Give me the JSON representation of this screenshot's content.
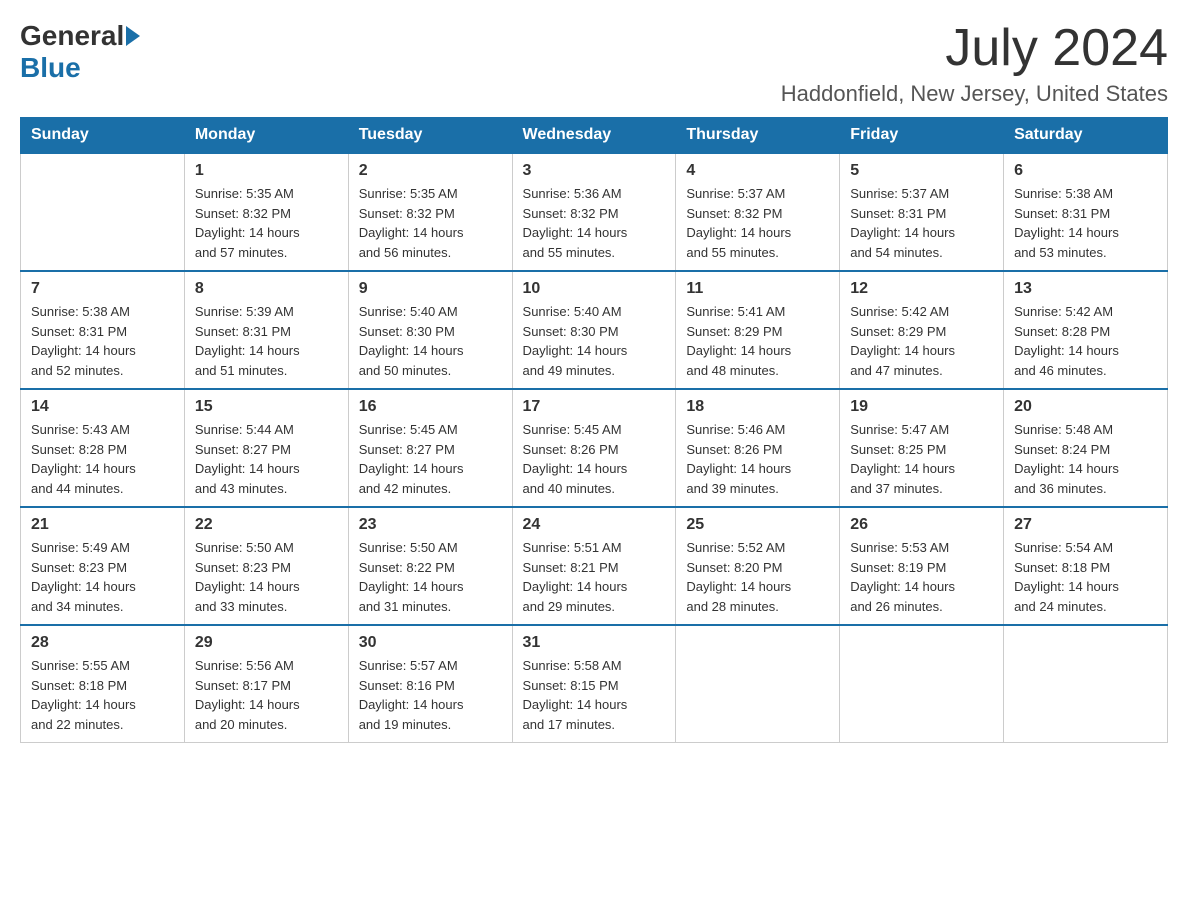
{
  "logo": {
    "general": "General",
    "blue": "Blue"
  },
  "title": {
    "month_year": "July 2024",
    "location": "Haddonfield, New Jersey, United States"
  },
  "days_of_week": [
    "Sunday",
    "Monday",
    "Tuesday",
    "Wednesday",
    "Thursday",
    "Friday",
    "Saturday"
  ],
  "weeks": [
    [
      {
        "day": "",
        "info": ""
      },
      {
        "day": "1",
        "info": "Sunrise: 5:35 AM\nSunset: 8:32 PM\nDaylight: 14 hours\nand 57 minutes."
      },
      {
        "day": "2",
        "info": "Sunrise: 5:35 AM\nSunset: 8:32 PM\nDaylight: 14 hours\nand 56 minutes."
      },
      {
        "day": "3",
        "info": "Sunrise: 5:36 AM\nSunset: 8:32 PM\nDaylight: 14 hours\nand 55 minutes."
      },
      {
        "day": "4",
        "info": "Sunrise: 5:37 AM\nSunset: 8:32 PM\nDaylight: 14 hours\nand 55 minutes."
      },
      {
        "day": "5",
        "info": "Sunrise: 5:37 AM\nSunset: 8:31 PM\nDaylight: 14 hours\nand 54 minutes."
      },
      {
        "day": "6",
        "info": "Sunrise: 5:38 AM\nSunset: 8:31 PM\nDaylight: 14 hours\nand 53 minutes."
      }
    ],
    [
      {
        "day": "7",
        "info": "Sunrise: 5:38 AM\nSunset: 8:31 PM\nDaylight: 14 hours\nand 52 minutes."
      },
      {
        "day": "8",
        "info": "Sunrise: 5:39 AM\nSunset: 8:31 PM\nDaylight: 14 hours\nand 51 minutes."
      },
      {
        "day": "9",
        "info": "Sunrise: 5:40 AM\nSunset: 8:30 PM\nDaylight: 14 hours\nand 50 minutes."
      },
      {
        "day": "10",
        "info": "Sunrise: 5:40 AM\nSunset: 8:30 PM\nDaylight: 14 hours\nand 49 minutes."
      },
      {
        "day": "11",
        "info": "Sunrise: 5:41 AM\nSunset: 8:29 PM\nDaylight: 14 hours\nand 48 minutes."
      },
      {
        "day": "12",
        "info": "Sunrise: 5:42 AM\nSunset: 8:29 PM\nDaylight: 14 hours\nand 47 minutes."
      },
      {
        "day": "13",
        "info": "Sunrise: 5:42 AM\nSunset: 8:28 PM\nDaylight: 14 hours\nand 46 minutes."
      }
    ],
    [
      {
        "day": "14",
        "info": "Sunrise: 5:43 AM\nSunset: 8:28 PM\nDaylight: 14 hours\nand 44 minutes."
      },
      {
        "day": "15",
        "info": "Sunrise: 5:44 AM\nSunset: 8:27 PM\nDaylight: 14 hours\nand 43 minutes."
      },
      {
        "day": "16",
        "info": "Sunrise: 5:45 AM\nSunset: 8:27 PM\nDaylight: 14 hours\nand 42 minutes."
      },
      {
        "day": "17",
        "info": "Sunrise: 5:45 AM\nSunset: 8:26 PM\nDaylight: 14 hours\nand 40 minutes."
      },
      {
        "day": "18",
        "info": "Sunrise: 5:46 AM\nSunset: 8:26 PM\nDaylight: 14 hours\nand 39 minutes."
      },
      {
        "day": "19",
        "info": "Sunrise: 5:47 AM\nSunset: 8:25 PM\nDaylight: 14 hours\nand 37 minutes."
      },
      {
        "day": "20",
        "info": "Sunrise: 5:48 AM\nSunset: 8:24 PM\nDaylight: 14 hours\nand 36 minutes."
      }
    ],
    [
      {
        "day": "21",
        "info": "Sunrise: 5:49 AM\nSunset: 8:23 PM\nDaylight: 14 hours\nand 34 minutes."
      },
      {
        "day": "22",
        "info": "Sunrise: 5:50 AM\nSunset: 8:23 PM\nDaylight: 14 hours\nand 33 minutes."
      },
      {
        "day": "23",
        "info": "Sunrise: 5:50 AM\nSunset: 8:22 PM\nDaylight: 14 hours\nand 31 minutes."
      },
      {
        "day": "24",
        "info": "Sunrise: 5:51 AM\nSunset: 8:21 PM\nDaylight: 14 hours\nand 29 minutes."
      },
      {
        "day": "25",
        "info": "Sunrise: 5:52 AM\nSunset: 8:20 PM\nDaylight: 14 hours\nand 28 minutes."
      },
      {
        "day": "26",
        "info": "Sunrise: 5:53 AM\nSunset: 8:19 PM\nDaylight: 14 hours\nand 26 minutes."
      },
      {
        "day": "27",
        "info": "Sunrise: 5:54 AM\nSunset: 8:18 PM\nDaylight: 14 hours\nand 24 minutes."
      }
    ],
    [
      {
        "day": "28",
        "info": "Sunrise: 5:55 AM\nSunset: 8:18 PM\nDaylight: 14 hours\nand 22 minutes."
      },
      {
        "day": "29",
        "info": "Sunrise: 5:56 AM\nSunset: 8:17 PM\nDaylight: 14 hours\nand 20 minutes."
      },
      {
        "day": "30",
        "info": "Sunrise: 5:57 AM\nSunset: 8:16 PM\nDaylight: 14 hours\nand 19 minutes."
      },
      {
        "day": "31",
        "info": "Sunrise: 5:58 AM\nSunset: 8:15 PM\nDaylight: 14 hours\nand 17 minutes."
      },
      {
        "day": "",
        "info": ""
      },
      {
        "day": "",
        "info": ""
      },
      {
        "day": "",
        "info": ""
      }
    ]
  ]
}
